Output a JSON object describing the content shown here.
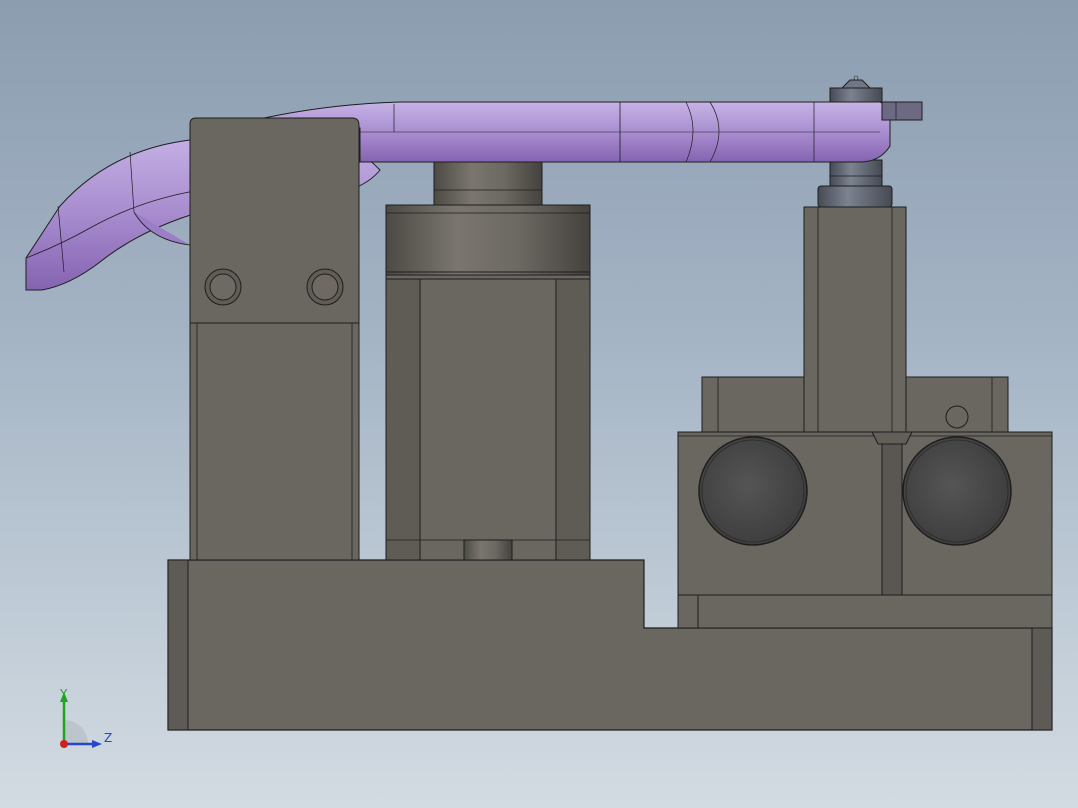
{
  "view": {
    "background_top": "#8c9db0",
    "background_bottom": "#d3dbe2"
  },
  "colors": {
    "body_gray": "#6a6660",
    "body_dark": "#57534d",
    "body_light": "#76726b",
    "edge": "#1e1e1e",
    "arm_purple": "#a98ed0",
    "arm_purple_dark": "#8a6db6",
    "knob_blue": "#5c6370",
    "hole_dark": "#4a4a4a"
  },
  "triad": {
    "y_label": "Y",
    "z_label": "Z",
    "y_color": "#1fa51f",
    "z_color": "#2547c9",
    "x_color": "#d21f1f"
  }
}
